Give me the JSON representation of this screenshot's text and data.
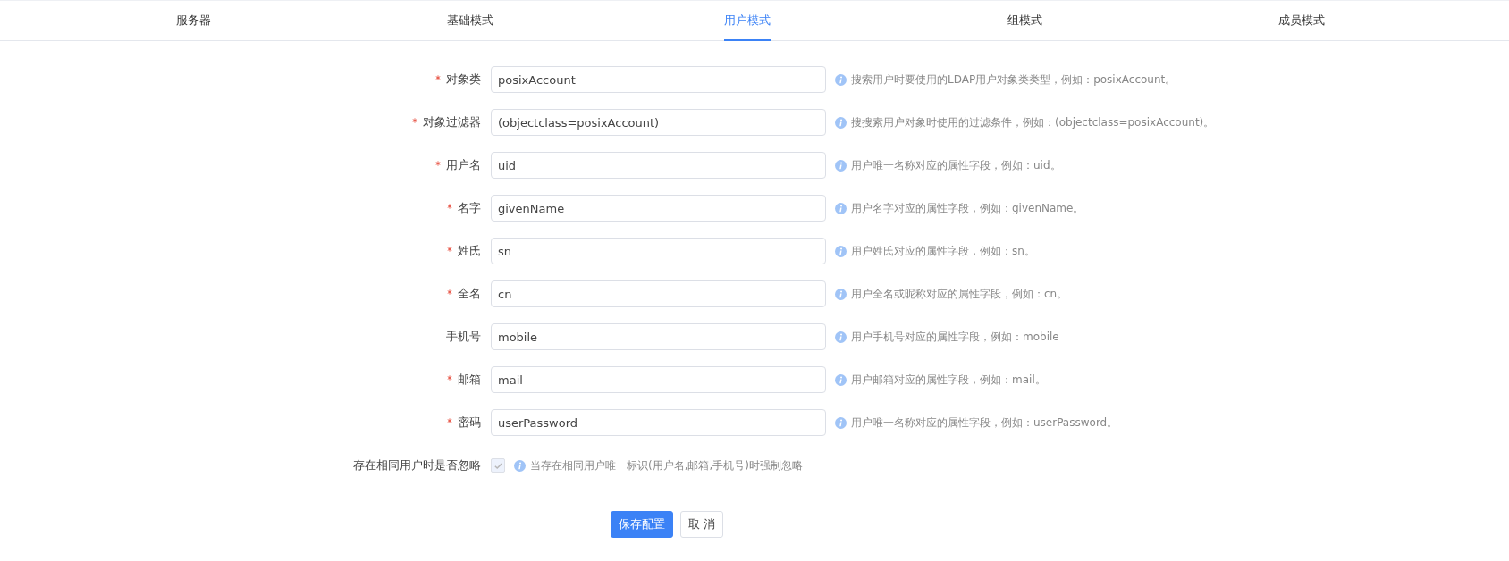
{
  "tabs": [
    {
      "label": "服务器",
      "selected": false
    },
    {
      "label": "基础模式",
      "selected": false
    },
    {
      "label": "用户模式",
      "selected": true
    },
    {
      "label": "组模式",
      "selected": false
    },
    {
      "label": "成员模式",
      "selected": false
    }
  ],
  "fields": [
    {
      "label": "对象类",
      "required": true,
      "value": "posixAccount",
      "hint": "搜索用户时要使用的LDAP用户对象类类型，例如：posixAccount。"
    },
    {
      "label": "对象过滤器",
      "required": true,
      "value": "(objectclass=posixAccount)",
      "hint": "搜搜索用户对象时使用的过滤条件，例如：(objectclass=posixAccount)。"
    },
    {
      "label": "用户名",
      "required": true,
      "value": "uid",
      "hint": "用户唯一名称对应的属性字段，例如：uid。"
    },
    {
      "label": "名字",
      "required": true,
      "value": "givenName",
      "hint": "用户名字对应的属性字段，例如：givenName。"
    },
    {
      "label": "姓氏",
      "required": true,
      "value": "sn",
      "hint": "用户姓氏对应的属性字段，例如：sn。"
    },
    {
      "label": "全名",
      "required": true,
      "value": "cn",
      "hint": "用户全名或昵称对应的属性字段，例如：cn。"
    },
    {
      "label": "手机号",
      "required": false,
      "value": "mobile",
      "hint": "用户手机号对应的属性字段，例如：mobile"
    },
    {
      "label": "邮箱",
      "required": true,
      "value": "mail",
      "hint": "用户邮箱对应的属性字段，例如：mail。"
    },
    {
      "label": "密码",
      "required": true,
      "value": "userPassword",
      "hint": "用户唯一名称对应的属性字段，例如：userPassword。"
    }
  ],
  "ignore_option": {
    "label": "存在相同用户时是否忽略",
    "checked": true,
    "disabled": true,
    "hint": "当存在相同用户唯一标识(用户名,邮箱,手机号)时强制忽略"
  },
  "buttons": {
    "save": "保存配置",
    "cancel": "取 消"
  }
}
